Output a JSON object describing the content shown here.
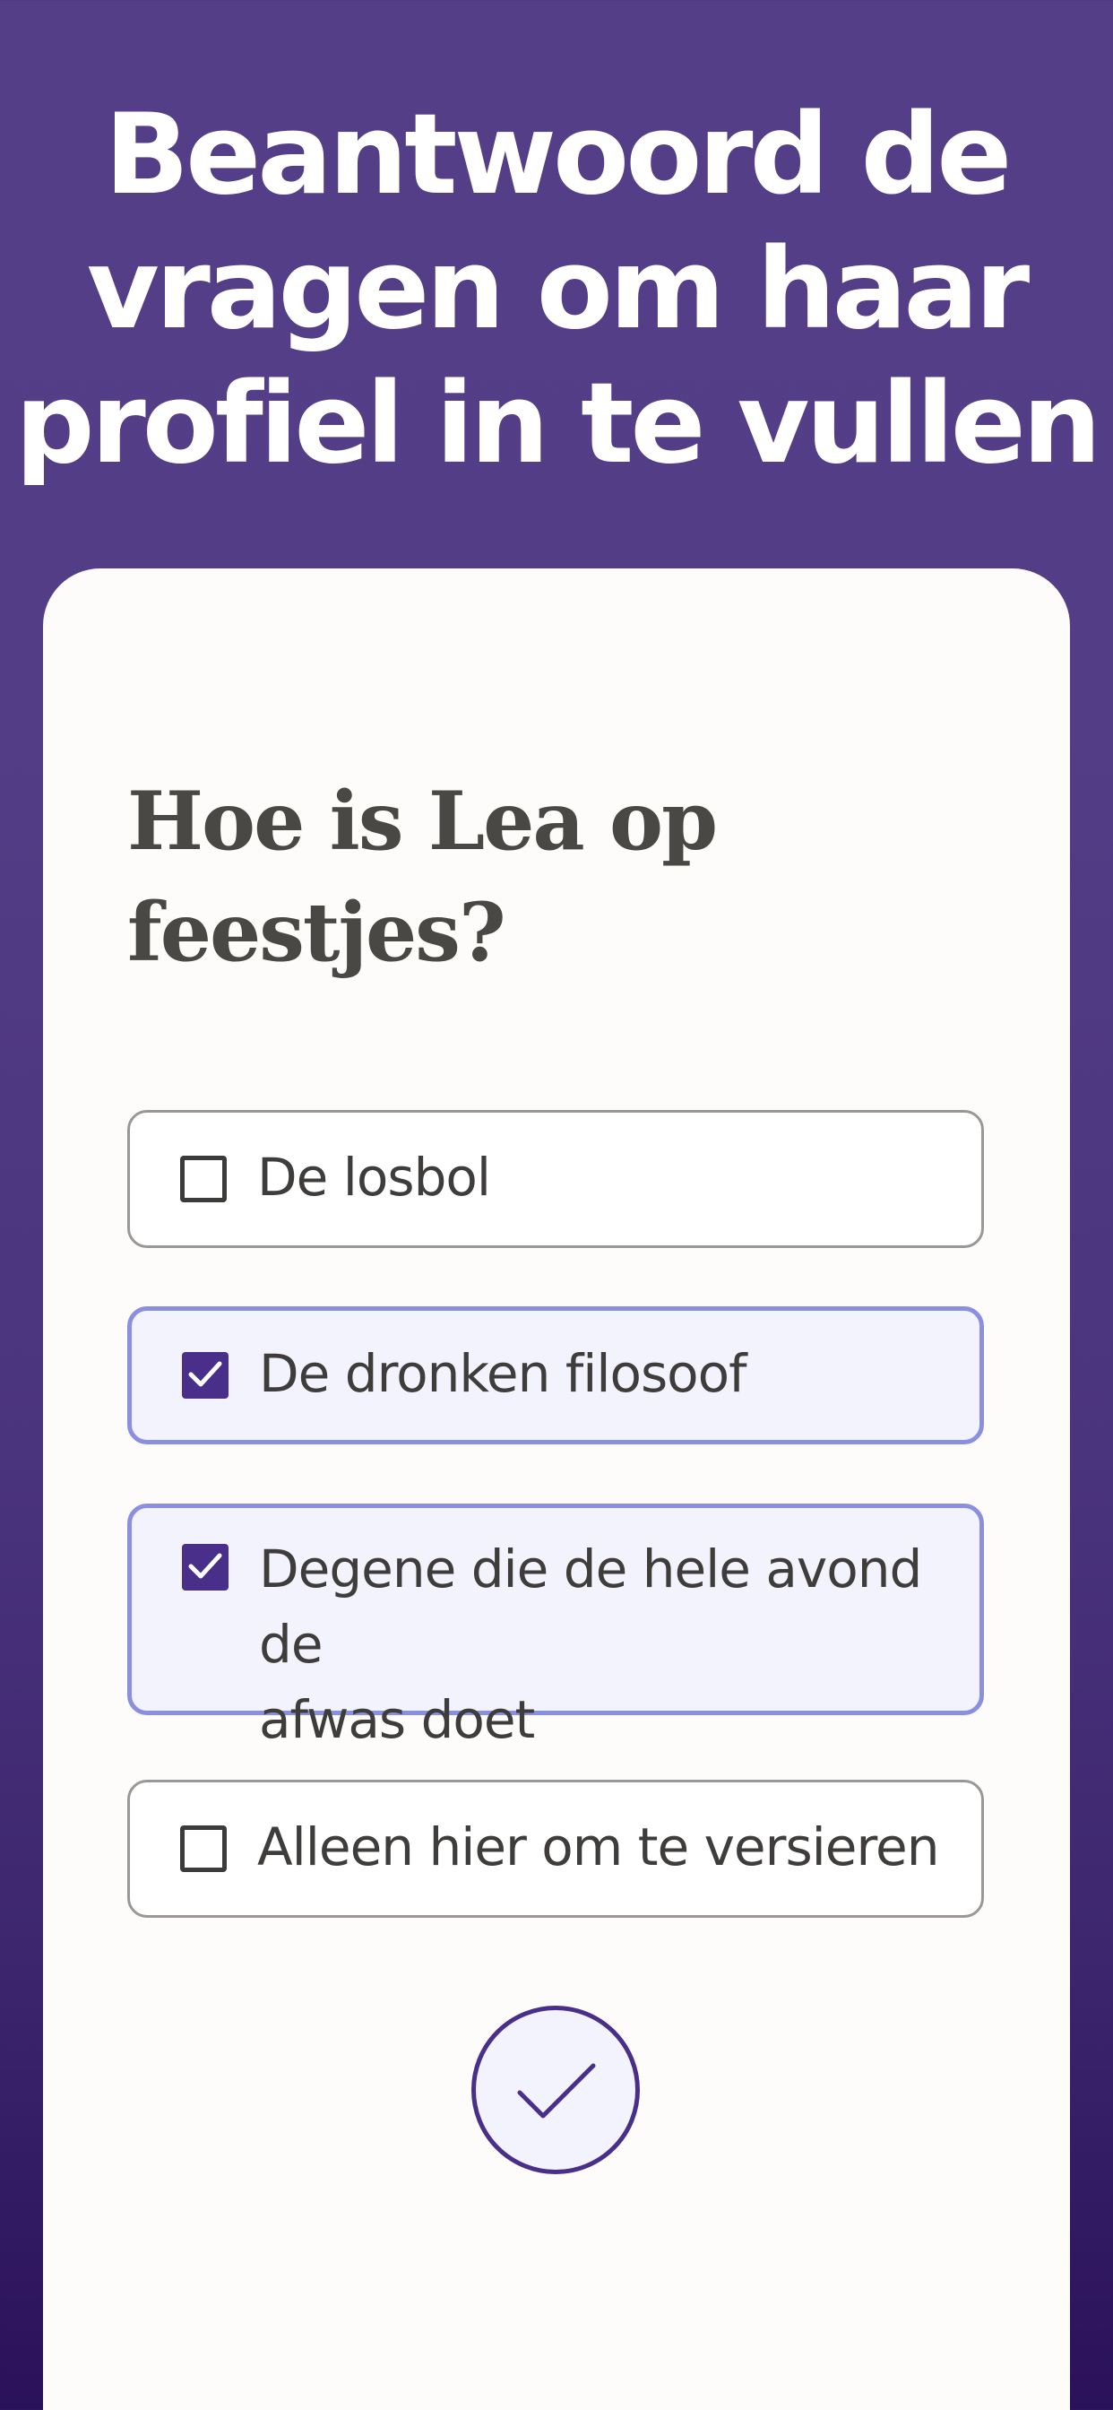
{
  "header": {
    "title_lines": [
      "Beantwoord de",
      "vragen om haar",
      "profiel in te vullen"
    ]
  },
  "question": {
    "lines": [
      "Hoe is Lea op",
      "feestjes?"
    ]
  },
  "options": [
    {
      "label": "De losbol",
      "checked": false
    },
    {
      "label": "De dronken filosoof",
      "checked": true
    },
    {
      "label": "Degene die de hele avond de",
      "label_line2": "afwas doet",
      "checked": true
    },
    {
      "label": "Alleen hier om te versieren",
      "checked": false
    }
  ],
  "icons": {
    "checkbox_checked": "check-icon",
    "submit": "checkmark-icon"
  },
  "colors": {
    "background_top": "#543e88",
    "background_bottom": "#2a1159",
    "accent": "#4a2f8a",
    "selected_border": "#8a8fe0",
    "selected_fill": "#f3f3fd"
  }
}
